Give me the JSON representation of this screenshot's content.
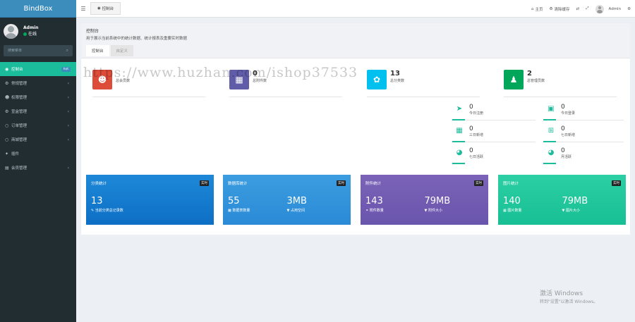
{
  "sidebar": {
    "logo": "BindBox",
    "user": {
      "name": "Admin",
      "status": "在线"
    },
    "search_placeholder": "搜索菜单",
    "items": [
      {
        "icon": "dashboard-icon",
        "label": "控制台",
        "badge": "hot",
        "active": true
      },
      {
        "icon": "cogs-icon",
        "label": "常规管理",
        "chevron": true
      },
      {
        "icon": "users-icon",
        "label": "权限管理",
        "chevron": true
      },
      {
        "icon": "gear-icon",
        "label": "宣盒管理",
        "chevron": true
      },
      {
        "icon": "circle-icon",
        "label": "订单管理",
        "chevron": true
      },
      {
        "icon": "circle-icon",
        "label": "商城管理",
        "chevron": true
      },
      {
        "icon": "magic-icon",
        "label": "插件"
      },
      {
        "icon": "list-icon",
        "label": "会员管理",
        "chevron": true
      }
    ]
  },
  "topbar": {
    "tab": "控制台",
    "links": {
      "home": "主页",
      "clear_cache": "清除缓存",
      "user": "Admin"
    }
  },
  "page": {
    "title": "控制台",
    "subtitle": "用于展示当前系统中的统计数据、统计报表及重要实时数据",
    "tabs": [
      "控制台",
      "自定义"
    ]
  },
  "big_cards": [
    {
      "value": "",
      "label": "总会员数",
      "color": "#dd4b39",
      "icon": "users-icon"
    },
    {
      "value": "0",
      "label": "总附件数",
      "color": "#605ca8",
      "icon": "image-icon"
    },
    {
      "value": "13",
      "label": "总分类数",
      "color": "#00c0ef",
      "icon": "leaf-icon"
    },
    {
      "value": "2",
      "label": "总管理员数",
      "color": "#00a65a",
      "icon": "user-icon"
    }
  ],
  "small_cards": [
    {
      "value": "0",
      "label": "今日注册",
      "icon": "rocket-icon"
    },
    {
      "value": "0",
      "label": "今日登录",
      "icon": "vcard-icon"
    },
    {
      "value": "0",
      "label": "三日新增",
      "icon": "calendar-icon"
    },
    {
      "value": "0",
      "label": "七日新增",
      "icon": "calendar-plus-icon"
    },
    {
      "value": "0",
      "label": "七日活跃",
      "icon": "user-circle-icon"
    },
    {
      "value": "0",
      "label": "月活跃",
      "icon": "user-circle-icon"
    }
  ],
  "stats": [
    {
      "title": "分类统计",
      "tag": "实时",
      "color": "#1e88d8",
      "color2": "#0d6fc4",
      "values": [
        {
          "num": "13",
          "label": "当前分类总记录数"
        }
      ]
    },
    {
      "title": "数据库统计",
      "tag": "实时",
      "color": "#3c9de0",
      "color2": "#2a8ad6",
      "values": [
        {
          "num": "55",
          "label": "数据表数量"
        },
        {
          "num": "3MB",
          "label": "占用空间"
        }
      ]
    },
    {
      "title": "附件统计",
      "tag": "实时",
      "color": "#7a63b8",
      "color2": "#6a55ad",
      "values": [
        {
          "num": "143",
          "label": "附件数量"
        },
        {
          "num": "79MB",
          "label": "附件大小"
        }
      ]
    },
    {
      "title": "图片统计",
      "tag": "实时",
      "color": "#2ccfa4",
      "color2": "#18bf94",
      "values": [
        {
          "num": "140",
          "label": "图片数量"
        },
        {
          "num": "79MB",
          "label": "图片大小"
        }
      ]
    }
  ],
  "watermark": "https://www.huzhan.com/ishop37533",
  "windows_activation": {
    "line1": "激活 Windows",
    "line2": "转到\"设置\"以激活 Windows。"
  }
}
